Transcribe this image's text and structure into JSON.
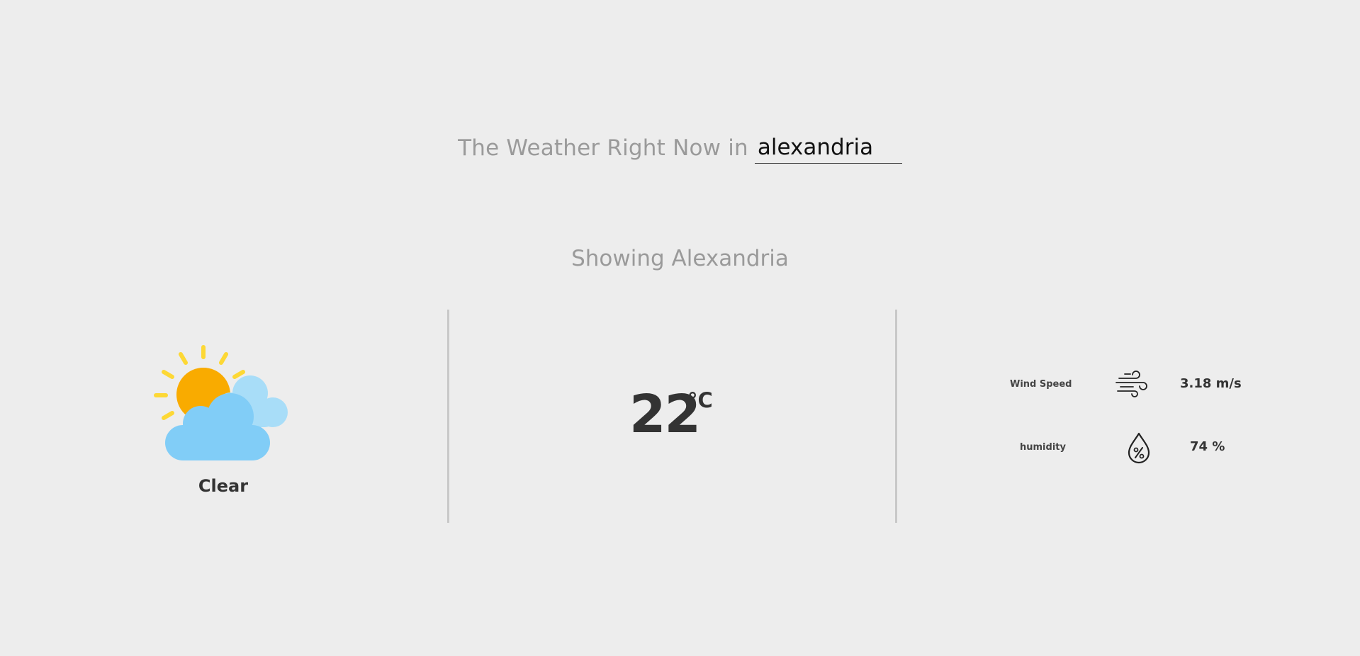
{
  "header": {
    "prefix": "The Weather Right Now in",
    "city_input_value": "alexandria",
    "city_input_placeholder": ""
  },
  "showing_text": "Showing Alexandria",
  "current": {
    "condition": "Clear",
    "condition_icon": "sun-behind-cloud-icon",
    "temperature": "22",
    "temperature_unit": "°C"
  },
  "stats": {
    "wind": {
      "label": "Wind Speed",
      "icon": "wind-icon",
      "value": "3.18 m/s"
    },
    "humidity": {
      "label": "humidity",
      "icon": "humidity-drop-icon",
      "value": "74 %"
    }
  },
  "colors": {
    "background": "#ededed",
    "muted_text": "#9a9a9a",
    "strong_text": "#333333",
    "divider": "#c8c8c8",
    "sun": "#F9AB00",
    "sun_rays": "#FDD835",
    "cloud_front": "#81CDF7",
    "cloud_back": "#A8DDF8"
  }
}
